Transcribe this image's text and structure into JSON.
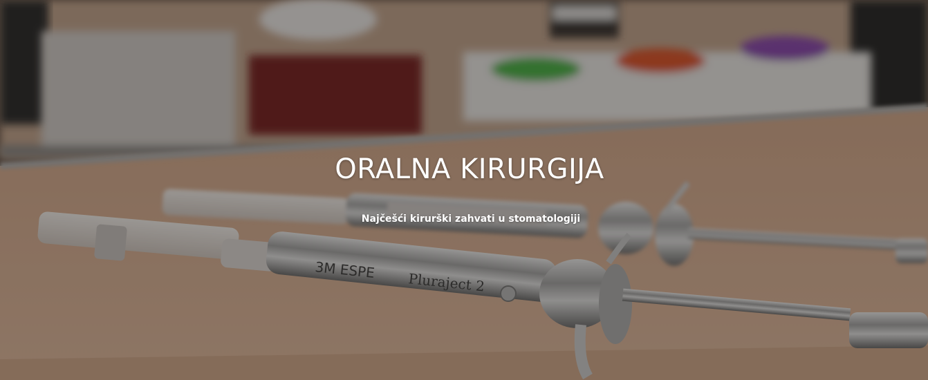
{
  "hero": {
    "title": "ORALNA KIRURGIJA",
    "subtitle": "Najčešći kirurški zahvati u stomatologiji",
    "image": "dental-anesthetic-syringes-photo",
    "syringe_engraving": "3M ESPE Pluraject 2"
  },
  "colors": {
    "overlay": "#14100e",
    "text": "#ffffff",
    "tray": "#e2b99d"
  }
}
